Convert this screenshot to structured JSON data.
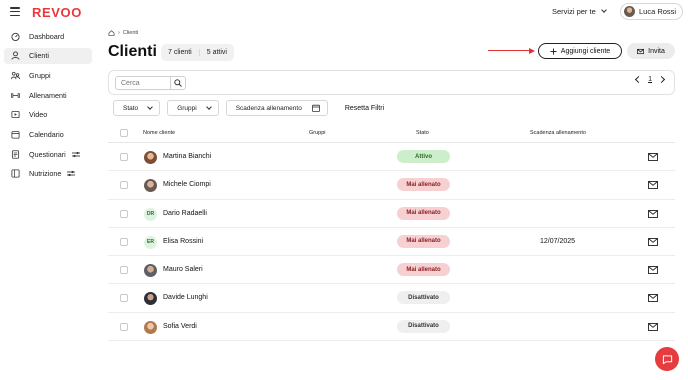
{
  "app": {
    "logo": "REVOO"
  },
  "header": {
    "services_label": "Servizi per te",
    "user_name": "Luca Rossi"
  },
  "sidebar": {
    "items": [
      {
        "label": "Dashboard",
        "icon": "dashboard-icon"
      },
      {
        "label": "Clienti",
        "icon": "user-icon",
        "active": true
      },
      {
        "label": "Gruppi",
        "icon": "group-icon"
      },
      {
        "label": "Allenamenti",
        "icon": "dumbbell-icon"
      },
      {
        "label": "Video",
        "icon": "video-icon"
      },
      {
        "label": "Calendario",
        "icon": "calendar-icon"
      },
      {
        "label": "Questionari",
        "icon": "questionnaire-icon",
        "extra_icon": "settings-sliders-icon"
      },
      {
        "label": "Nutrizione",
        "icon": "nutrition-icon",
        "extra_icon": "settings-sliders-icon"
      }
    ]
  },
  "breadcrumb": {
    "current": "Clienti"
  },
  "page": {
    "title": "Clienti",
    "count_clients": "7 clienti",
    "count_active": "5 attivi"
  },
  "actions": {
    "add_client": "Aggiungi cliente",
    "invite": "Invita"
  },
  "search": {
    "placeholder": "Cerca"
  },
  "pagination": {
    "page": "1"
  },
  "filters": {
    "stato": "Stato",
    "gruppi": "Gruppi",
    "scadenza": "Scadenza allenamento",
    "reset": "Resetta Filtri"
  },
  "table": {
    "headers": {
      "name": "Nome cliente",
      "groups": "Gruppi",
      "status": "Stato",
      "expiry": "Scadenza allenamento"
    },
    "rows": [
      {
        "name": "Martina Bianchi",
        "initials": "",
        "avatar": "photo",
        "status": "Attivo",
        "status_type": "attivo",
        "expiry": ""
      },
      {
        "name": "Michele Ciompi",
        "initials": "",
        "avatar": "photo",
        "status": "Mai allenato",
        "status_type": "mai",
        "expiry": ""
      },
      {
        "name": "Dario Radaelli",
        "initials": "DR",
        "avatar": "initials",
        "status": "Mai allenato",
        "status_type": "mai",
        "expiry": ""
      },
      {
        "name": "Elisa Rossini",
        "initials": "ER",
        "avatar": "initials",
        "status": "Mai allenato",
        "status_type": "mai",
        "expiry": "12/07/2025"
      },
      {
        "name": "Mauro Saleri",
        "initials": "",
        "avatar": "photo",
        "status": "Mai allenato",
        "status_type": "mai",
        "expiry": ""
      },
      {
        "name": "Davide Lunghi",
        "initials": "",
        "avatar": "photo",
        "status": "Disattivato",
        "status_type": "disatt",
        "expiry": ""
      },
      {
        "name": "Sofia Verdi",
        "initials": "",
        "avatar": "photo",
        "status": "Disattivato",
        "status_type": "disatt",
        "expiry": ""
      }
    ]
  },
  "colors": {
    "brand": "#e8383d",
    "active_badge": "#cdeecb",
    "never_badge": "#f7d1d2",
    "disabled_badge": "#efefef"
  }
}
